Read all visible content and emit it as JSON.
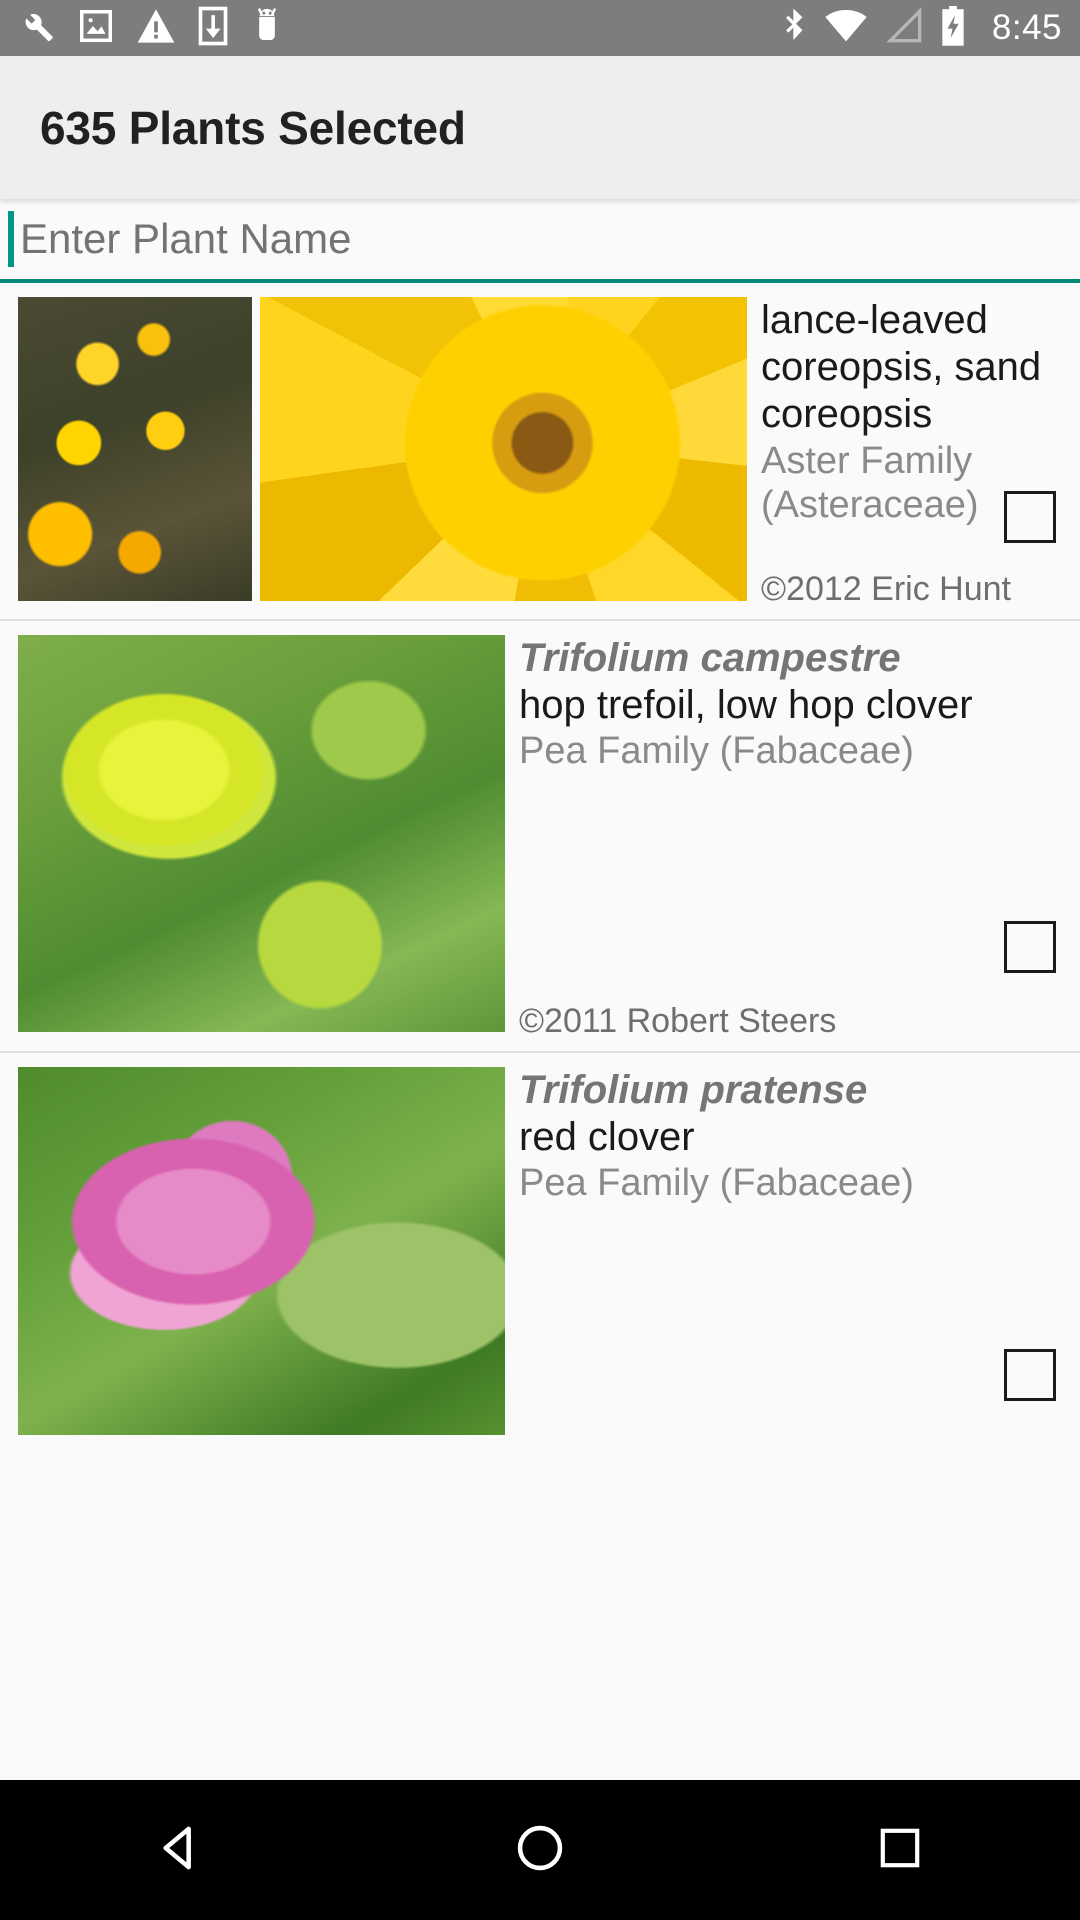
{
  "status_bar": {
    "time": "8:45",
    "left_icons": [
      "wrench-icon",
      "image-icon",
      "warning-triangle-icon",
      "download-icon",
      "android-robot-icon"
    ],
    "right_icons": [
      "bluetooth-icon",
      "wifi-icon",
      "cellular-signal-icon",
      "battery-charging-icon"
    ],
    "background_color": "#7d7d7d",
    "icon_color": "#ffffff"
  },
  "app_bar": {
    "title": "635 Plants Selected",
    "background_color": "#eeeeee",
    "text_color": "#212121"
  },
  "search": {
    "placeholder": "Enter Plant Name",
    "value": "",
    "underline_color": "#00897b",
    "caret_color": "#009688"
  },
  "plant_list": [
    {
      "scientific_name": "",
      "common_name": "lance-leaved coreopsis, sand coreopsis",
      "family": "Aster Family (Asteraceae)",
      "credit": "©2012 Eric Hunt",
      "checkbox_checked": false,
      "thumbnails": [
        "coreopsis-field-photo",
        "coreopsis-closeup-photo"
      ]
    },
    {
      "scientific_name": "Trifolium campestre",
      "common_name": "hop trefoil, low hop clover",
      "family": "Pea Family (Fabaceae)",
      "credit": "©2011 Robert Steers",
      "checkbox_checked": false,
      "thumbnails": [
        "hop-trefoil-photo"
      ]
    },
    {
      "scientific_name": "Trifolium pratense",
      "common_name": "red clover",
      "family": "Pea Family (Fabaceae)",
      "credit": "",
      "checkbox_checked": false,
      "thumbnails": [
        "red-clover-photo"
      ]
    }
  ],
  "nav_bar": {
    "background_color": "#000000",
    "buttons": [
      "back-button",
      "home-button",
      "recents-button"
    ]
  }
}
